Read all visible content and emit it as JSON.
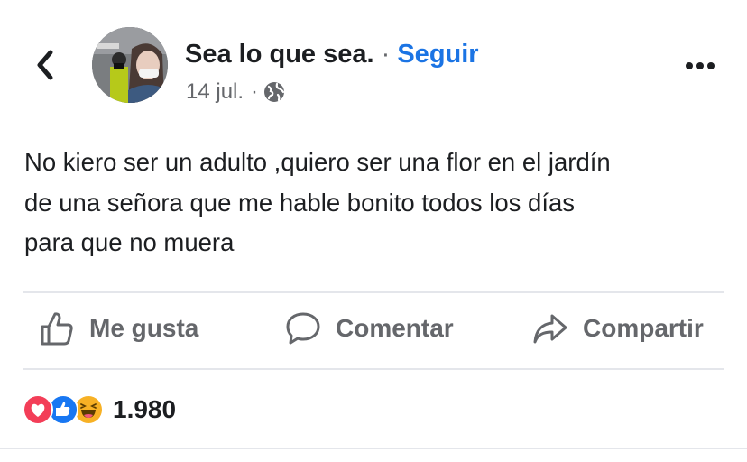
{
  "header": {
    "back_icon": "chevron-left-icon",
    "author_name": "Sea lo que sea.",
    "separator": "·",
    "follow_label": "Seguir",
    "date": "14 jul.",
    "meta_separator": "·",
    "privacy_icon": "globe-icon",
    "more_icon": "ellipsis-icon"
  },
  "post": {
    "text": "No kiero ser un adulto ,quiero ser una flor en el jardín\nde una señora que me hable bonito todos los días\npara que no muera"
  },
  "actions": [
    {
      "icon": "thumbs-up-icon",
      "label": "Me gusta"
    },
    {
      "icon": "comment-icon",
      "label": "Comentar"
    },
    {
      "icon": "share-icon",
      "label": "Compartir"
    }
  ],
  "reactions": {
    "icons": [
      "love-reaction-icon",
      "like-reaction-icon",
      "haha-reaction-icon"
    ],
    "count": "1.980"
  },
  "colors": {
    "link_blue": "#1b74e4",
    "secondary_gray": "#65676b",
    "love_red": "#f33e58",
    "like_blue": "#1877f2",
    "haha_yellow": "#f7b125"
  }
}
